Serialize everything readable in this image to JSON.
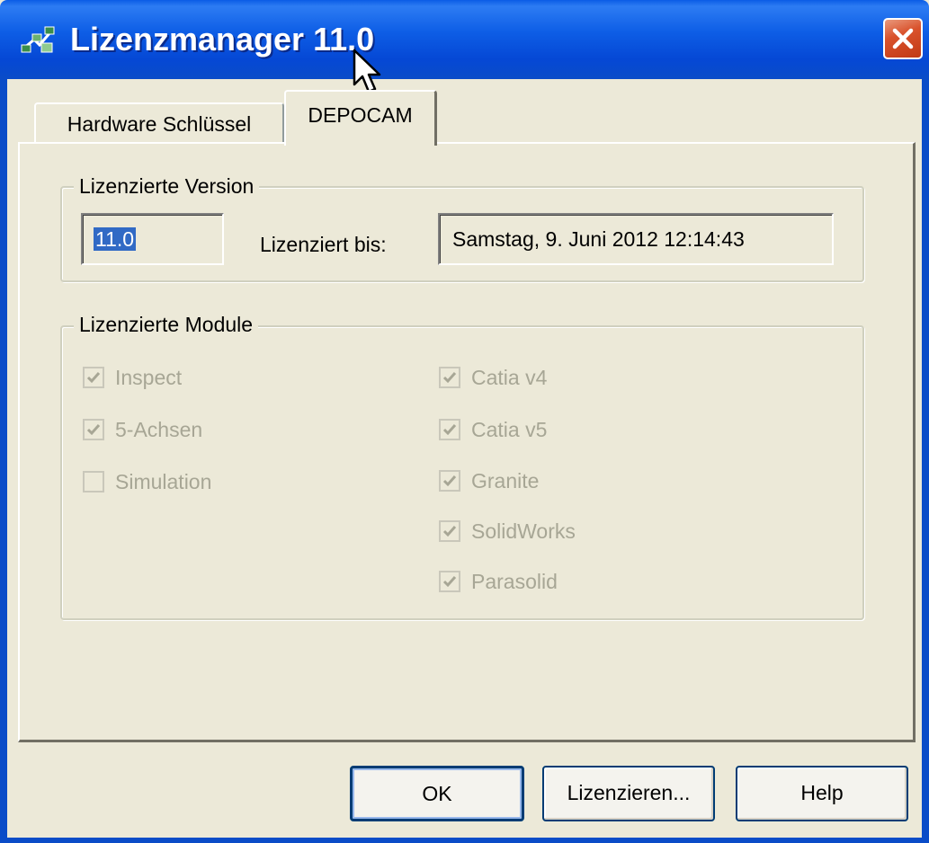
{
  "window": {
    "title": "Lizenzmanager 11.0"
  },
  "tabs": [
    {
      "label": "Hardware Schlüssel",
      "active": false
    },
    {
      "label": "DEPOCAM",
      "active": true
    }
  ],
  "version_group": {
    "legend": "Lizenzierte Version",
    "version_value": "11.0",
    "licensed_until_label": "Lizenziert bis:",
    "licensed_until_value": "Samstag, 9. Juni 2012 12:14:43"
  },
  "modules_group": {
    "legend": "Lizenzierte Module",
    "left_column": [
      {
        "label": "Inspect",
        "checked": true,
        "enabled": false
      },
      {
        "label": "5-Achsen",
        "checked": true,
        "enabled": false
      },
      {
        "label": "Simulation",
        "checked": false,
        "enabled": false
      }
    ],
    "right_column": [
      {
        "label": "Catia v4",
        "checked": true,
        "enabled": false
      },
      {
        "label": "Catia v5",
        "checked": true,
        "enabled": false
      },
      {
        "label": "Granite",
        "checked": true,
        "enabled": false
      },
      {
        "label": "SolidWorks",
        "checked": true,
        "enabled": false
      },
      {
        "label": "Parasolid",
        "checked": true,
        "enabled": false
      }
    ]
  },
  "buttons": {
    "ok": "OK",
    "license": "Lizenzieren...",
    "help": "Help"
  },
  "colors": {
    "titlebar": "#0548D5",
    "dialog_bg": "#ECE9D8",
    "selection": "#316AC5",
    "disabled_text": "#A7A695",
    "close_button": "#D9522C"
  },
  "icons": {
    "app": "network-app-icon",
    "close": "close-icon",
    "cursor": "mouse-cursor-icon",
    "check": "checkmark-icon"
  }
}
